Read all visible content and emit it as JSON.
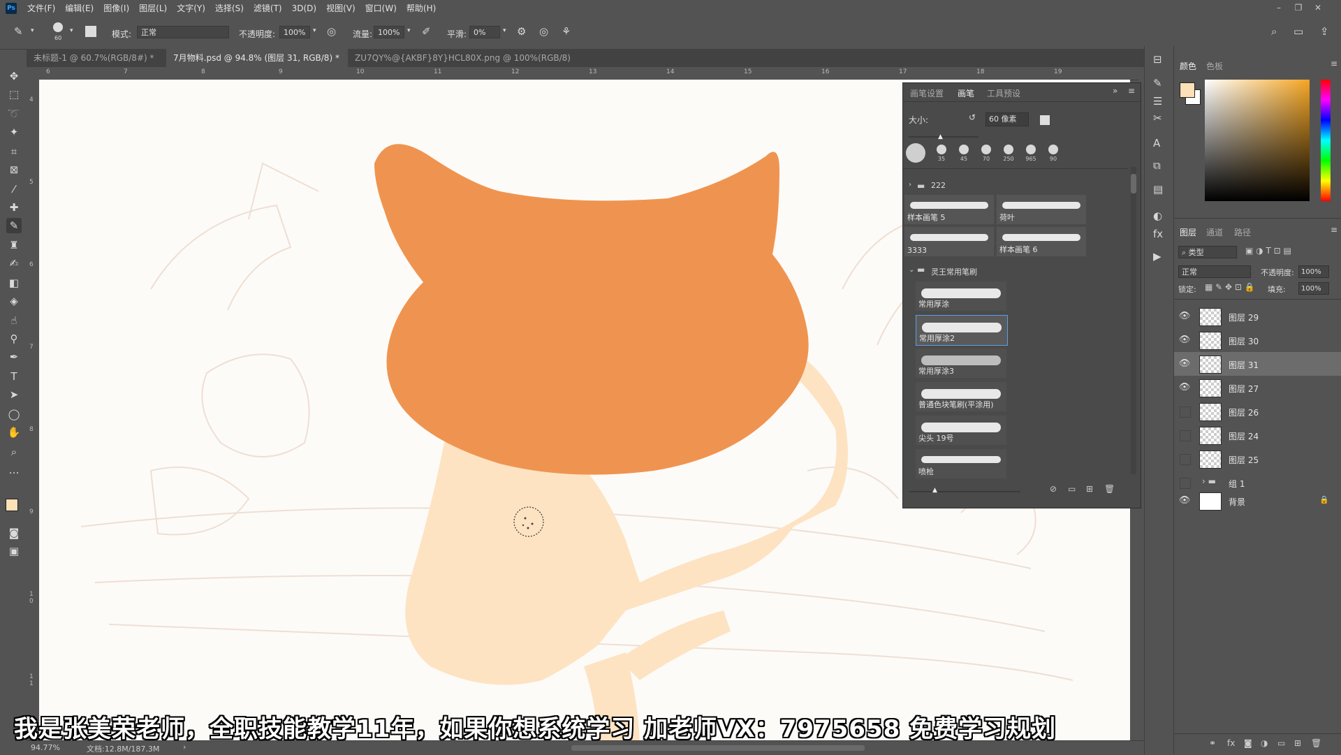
{
  "app": {
    "logo": "Ps",
    "menu": [
      "文件(F)",
      "编辑(E)",
      "图像(I)",
      "图层(L)",
      "文字(Y)",
      "选择(S)",
      "滤镜(T)",
      "3D(D)",
      "视图(V)",
      "窗口(W)",
      "帮助(H)"
    ]
  },
  "options": {
    "brush_size": "60",
    "mode_label": "模式:",
    "mode_value": "正常",
    "opacity_label": "不透明度:",
    "opacity_value": "100%",
    "flow_label": "流量:",
    "flow_value": "100%",
    "smooth_label": "平滑:",
    "smooth_value": "0%"
  },
  "tabs": [
    {
      "label": "未标题-1 @ 60.7%(RGB/8#) *",
      "close": "×"
    },
    {
      "label": "7月物料.psd @ 94.8% (图层 31, RGB/8) *",
      "close": "×"
    },
    {
      "label": "ZU7QY%@{AKBF}8Y}HCL80X.png @ 100%(RGB/8)",
      "close": "×"
    }
  ],
  "ruler": {
    "h": [
      "6",
      "7",
      "8",
      "9",
      "10",
      "11",
      "12",
      "13",
      "14",
      "15",
      "16",
      "17",
      "18",
      "19"
    ],
    "v": [
      "4",
      "5",
      "6",
      "7",
      "8",
      "9",
      "1 0",
      "1 1"
    ]
  },
  "brush_panel": {
    "tabs": [
      "画笔设置",
      "画笔",
      "工具预设"
    ],
    "size_label": "大小:",
    "size_value": "60 像素",
    "presets": [
      "35",
      "45",
      "70",
      "250",
      "965",
      "90"
    ],
    "group1": "222",
    "group1_strokes": [
      "样本画笔 5",
      "荷叶",
      "3333",
      "样本画笔 6"
    ],
    "group2": "灵王常用笔刷",
    "group2_strokes": [
      "常用厚涂",
      "常用厚涂2",
      "常用厚涂3",
      "普通色块笔刷(平涂用)",
      "尖头 19号",
      "喷枪"
    ]
  },
  "color_panel": {
    "tabs": [
      "颜色",
      "色板"
    ],
    "fg_color": "#fbe0b8",
    "bg_color": "#ffffff",
    "hue_color": "#f5a623"
  },
  "layers_panel": {
    "tabs": [
      "图层",
      "通道",
      "路径"
    ],
    "filter": "类型",
    "blend": "正常",
    "opacity_label": "不透明度:",
    "opacity_value": "100%",
    "lock_label": "锁定:",
    "fill_label": "填充:",
    "fill_value": "100%",
    "layers": [
      {
        "name": "图层 29",
        "visible": true,
        "selected": false
      },
      {
        "name": "图层 30",
        "visible": true,
        "selected": false
      },
      {
        "name": "图层 31",
        "visible": true,
        "selected": true
      },
      {
        "name": "图层 27",
        "visible": true,
        "selected": false
      },
      {
        "name": "图层 26",
        "visible": false,
        "selected": false
      },
      {
        "name": "图层 24",
        "visible": false,
        "selected": false
      },
      {
        "name": "图层 25",
        "visible": false,
        "selected": false
      },
      {
        "name": "组 1",
        "visible": false,
        "selected": false
      },
      {
        "name": "背景",
        "visible": true,
        "selected": false
      }
    ]
  },
  "status": {
    "zoom": "94.77%",
    "doc": "文档:12.8M/187.3M"
  },
  "subtitle": "我是张美荣老师，全职技能教学11年，如果你想系统学习 加老师VX：7975658 免费学习规划",
  "colors": {
    "head": "#ef9450",
    "body": "#fde3c2",
    "sketch": "#eedfd3"
  }
}
